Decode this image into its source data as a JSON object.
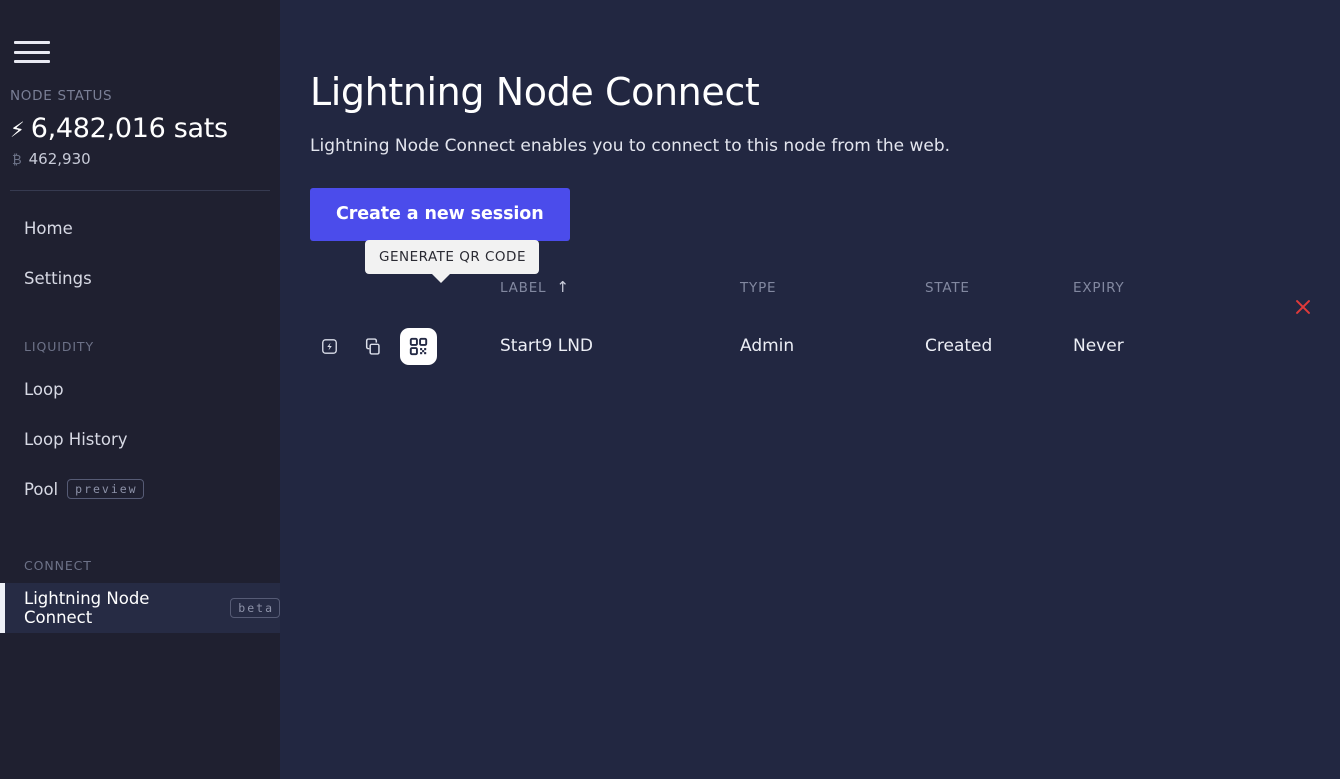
{
  "sidebar": {
    "menu_icon": "hamburger-icon",
    "node_status": {
      "label": "NODE STATUS",
      "lightning_glyph": "⚡",
      "lightning_balance": "6,482,016 sats",
      "bitcoin_glyph": "₿",
      "bitcoin_balance": "462,930"
    },
    "items": [
      {
        "label": "Home",
        "badge": null,
        "active": false
      },
      {
        "label": "Settings",
        "badge": null,
        "active": false
      }
    ],
    "sections": [
      {
        "title": "LIQUIDITY",
        "items": [
          {
            "label": "Loop",
            "badge": null,
            "active": false
          },
          {
            "label": "Loop History",
            "badge": null,
            "active": false
          },
          {
            "label": "Pool",
            "badge": "preview",
            "active": false
          }
        ]
      },
      {
        "title": "CONNECT",
        "items": [
          {
            "label": "Lightning Node Connect",
            "badge": "beta",
            "active": true
          }
        ]
      }
    ]
  },
  "main": {
    "title": "Lightning Node Connect",
    "subtitle": "Lightning Node Connect enables you to connect to this node from the web.",
    "create_button": "Create a new session",
    "tooltip": "GENERATE QR CODE",
    "table": {
      "columns": [
        "LABEL",
        "TYPE",
        "STATE",
        "EXPIRY"
      ],
      "sort_column": "LABEL",
      "sort_arrow": "↑",
      "rows": [
        {
          "icons": [
            "lightning-box-icon",
            "copy-icon",
            "qr-code-icon"
          ],
          "label": "Start9 LND",
          "type": "Admin",
          "state": "Created",
          "expiry": "Never",
          "delete_glyph": "✕"
        }
      ]
    }
  },
  "colors": {
    "sidebar_bg": "#1f2030",
    "main_bg": "#222741",
    "accent": "#4b4ceb",
    "active_row_bg": "#262b44",
    "delete": "#e03a3a",
    "tooltip_bg": "#f2f2f2",
    "muted_text": "#7a7f96"
  }
}
